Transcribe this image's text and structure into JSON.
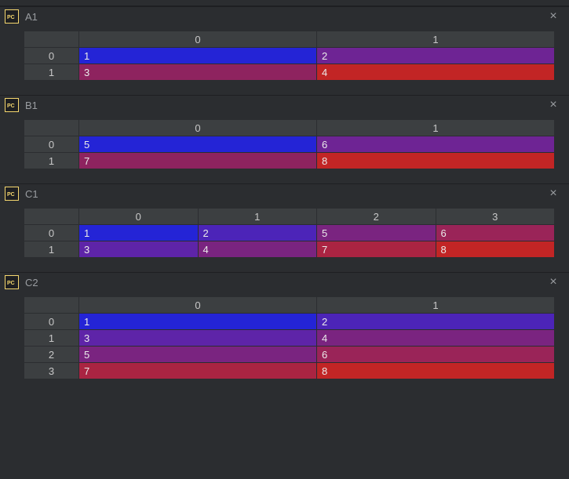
{
  "icon_label": "PC",
  "panels": [
    {
      "title": "A1",
      "col_headers": [
        "0",
        "1"
      ],
      "row_headers": [
        "0",
        "1"
      ],
      "cells": [
        [
          {
            "v": "1",
            "bg": "#2424d6"
          },
          {
            "v": "2",
            "bg": "#6e2494"
          }
        ],
        [
          {
            "v": "3",
            "bg": "#8e235f"
          },
          {
            "v": "4",
            "bg": "#c22525"
          }
        ]
      ]
    },
    {
      "title": "B1",
      "col_headers": [
        "0",
        "1"
      ],
      "row_headers": [
        "0",
        "1"
      ],
      "cells": [
        [
          {
            "v": "5",
            "bg": "#2424d6"
          },
          {
            "v": "6",
            "bg": "#6e2494"
          }
        ],
        [
          {
            "v": "7",
            "bg": "#8e235f"
          },
          {
            "v": "8",
            "bg": "#c22525"
          }
        ]
      ]
    },
    {
      "title": "C1",
      "col_headers": [
        "0",
        "1",
        "2",
        "3"
      ],
      "row_headers": [
        "0",
        "1"
      ],
      "cells": [
        [
          {
            "v": "1",
            "bg": "#2424d6"
          },
          {
            "v": "2",
            "bg": "#4c24b8"
          },
          {
            "v": "5",
            "bg": "#7a2480"
          },
          {
            "v": "6",
            "bg": "#9a2458"
          }
        ],
        [
          {
            "v": "3",
            "bg": "#5e24a8"
          },
          {
            "v": "4",
            "bg": "#7a2480"
          },
          {
            "v": "7",
            "bg": "#aa2442"
          },
          {
            "v": "8",
            "bg": "#c22525"
          }
        ]
      ]
    },
    {
      "title": "C2",
      "col_headers": [
        "0",
        "1"
      ],
      "row_headers": [
        "0",
        "1",
        "2",
        "3"
      ],
      "cells": [
        [
          {
            "v": "1",
            "bg": "#2424d6"
          },
          {
            "v": "2",
            "bg": "#4c24b8"
          }
        ],
        [
          {
            "v": "3",
            "bg": "#5e24a8"
          },
          {
            "v": "4",
            "bg": "#7a2480"
          }
        ],
        [
          {
            "v": "5",
            "bg": "#7a2480"
          },
          {
            "v": "6",
            "bg": "#9a2458"
          }
        ],
        [
          {
            "v": "7",
            "bg": "#aa2442"
          },
          {
            "v": "8",
            "bg": "#c22525"
          }
        ]
      ]
    }
  ]
}
